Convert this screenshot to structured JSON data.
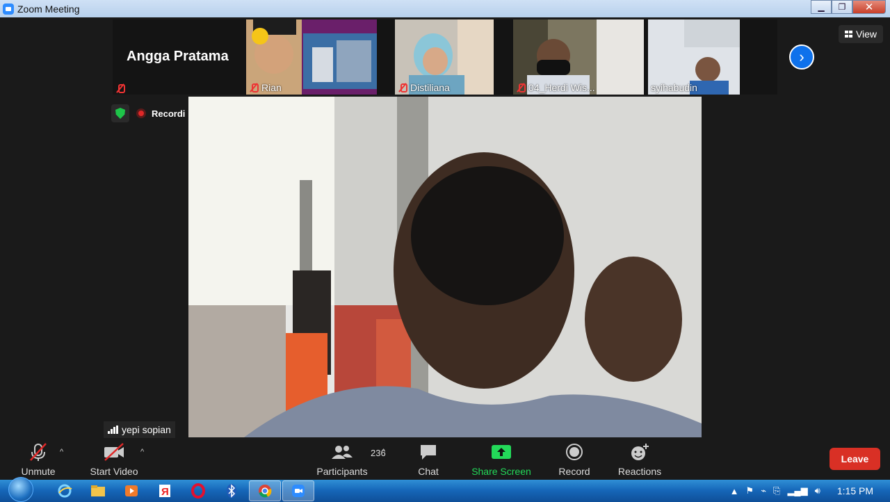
{
  "window": {
    "title": "Zoom Meeting"
  },
  "gallery": {
    "name_only_tile": "Angga Pratama",
    "participants": [
      {
        "name": "Rian",
        "muted": true
      },
      {
        "name": "Distiliana",
        "muted": true
      },
      {
        "name": "04_Herdi Wis...",
        "muted": true
      },
      {
        "name": "syihabudin",
        "muted": false
      }
    ],
    "view_label": "View"
  },
  "status": {
    "recording_label": "Recordi"
  },
  "active_speaker": {
    "name": "yepi sopian"
  },
  "toolbar": {
    "unmute": "Unmute",
    "start_video": "Start Video",
    "participants": "Participants",
    "participant_count": "236",
    "chat": "Chat",
    "share_screen": "Share Screen",
    "record": "Record",
    "reactions": "Reactions",
    "leave": "Leave"
  },
  "taskbar": {
    "clock": "1:15 PM"
  },
  "colors": {
    "accent": "#0e71eb",
    "leave": "#d93025",
    "share": "#23d959",
    "shield": "#1ec449"
  }
}
